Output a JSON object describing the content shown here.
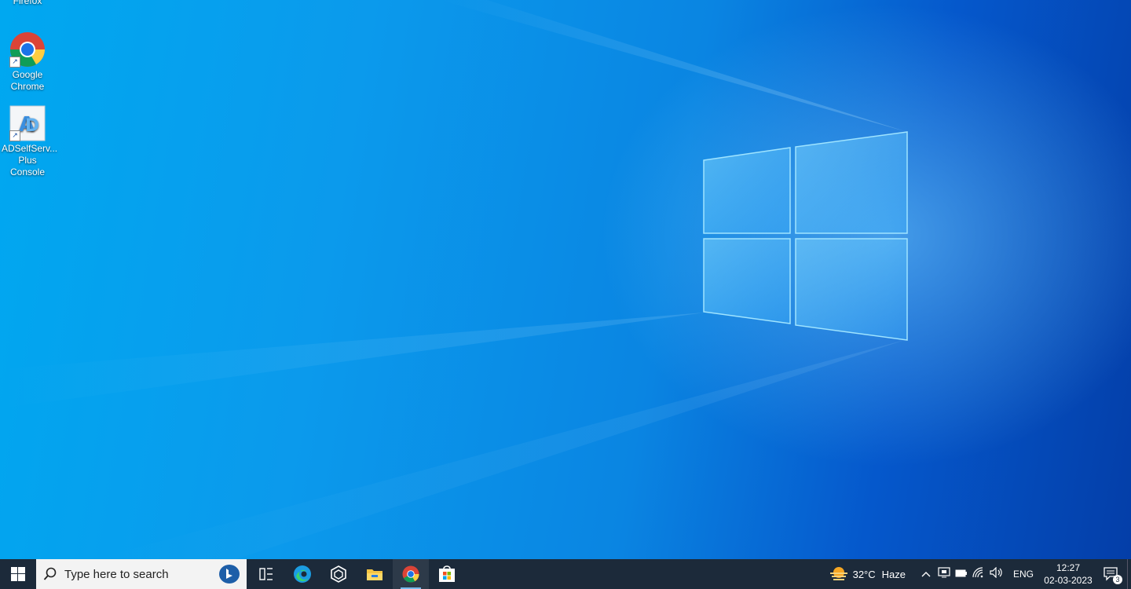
{
  "desktop": {
    "icons": [
      {
        "label": "Firefox"
      },
      {
        "label": "Google\nChrome"
      },
      {
        "label": "ADSelfServ...\nPlus Console"
      }
    ]
  },
  "taskbar": {
    "search_placeholder": "Type here to search",
    "pinned": [
      {
        "name": "task-view-icon"
      },
      {
        "name": "edge-icon"
      },
      {
        "name": "cube-app-icon"
      },
      {
        "name": "file-explorer-icon"
      },
      {
        "name": "chrome-icon",
        "active": true
      },
      {
        "name": "store-icon"
      }
    ],
    "weather": {
      "temp": "32°C",
      "condition": "Haze"
    },
    "language": "ENG",
    "time": "12:27",
    "date": "02-03-2023",
    "notification_count": "3"
  },
  "colors": {
    "taskbar": "#1c2a3a",
    "accent": "#76b9ed",
    "wallpaper": "#0a85e2"
  }
}
